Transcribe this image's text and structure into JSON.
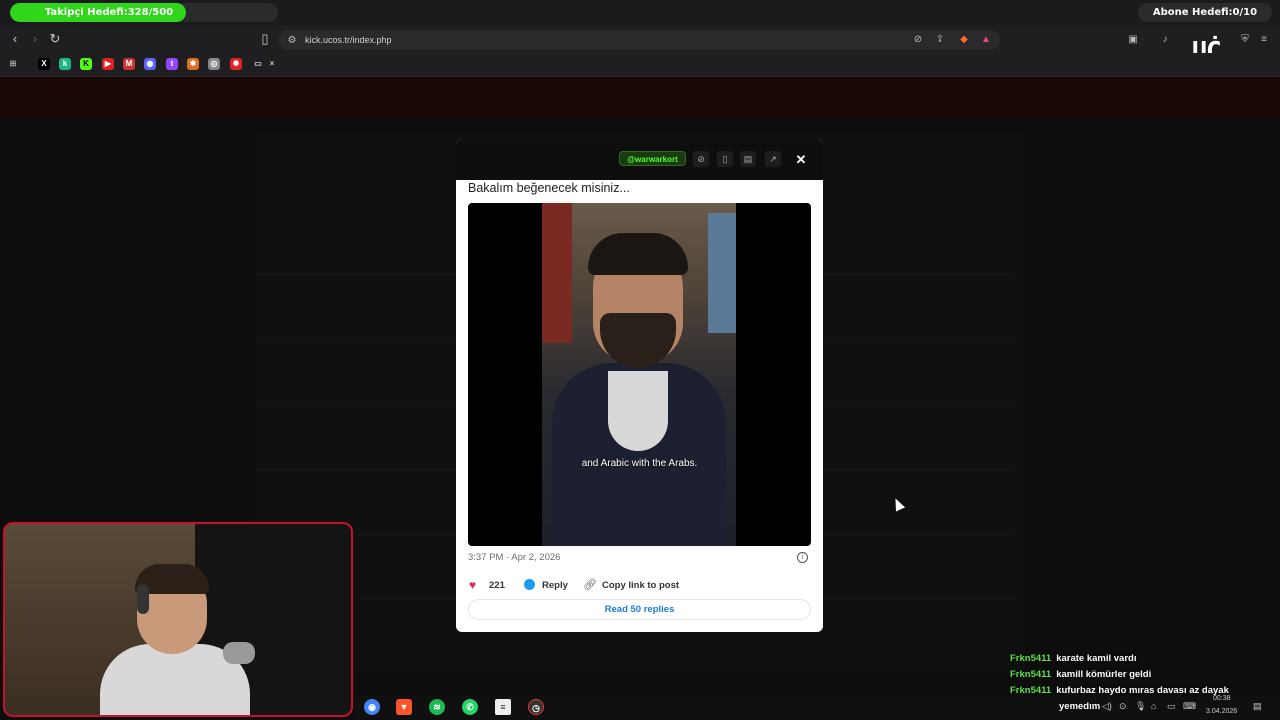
{
  "overlay": {
    "follow_goal": "Takipçi Hedefi:328/500",
    "follow_progress": 0.656,
    "sub_goal": "Abone Hedefi:0/10",
    "brand_logo": "UCO"
  },
  "browser": {
    "url": "kick.ucos.tr/index.php",
    "bookmarks": [
      "x-icon",
      "k-icon",
      "kick-icon",
      "youtube-icon",
      "gmail-icon",
      "discord-icon",
      "twitch-icon",
      "cog-icon",
      "circle-icon",
      "star-icon",
      "folder-icon"
    ]
  },
  "modal": {
    "handle": "@warwarkort",
    "tweet_text": "Bakalım beğenecek misiniz...",
    "subtitle": "and Arabic with the Arabs.",
    "timestamp": "3:37 PM · Apr 2, 2026",
    "likes": "221",
    "reply_label": "Reply",
    "copy_label": "Copy link to post",
    "read_replies": "Read 50 replies"
  },
  "chat": [
    {
      "user": "Frkn5411",
      "message": "karate kamil vardı"
    },
    {
      "user": "Frkn5411",
      "message": "kamill kömürler geldi"
    },
    {
      "user": "Frkn5411",
      "message": "kufurbaz haydo mıras davası az dayak"
    }
  ],
  "taskbar": {
    "tray_word": "yemedım",
    "time": "00:38",
    "date": "3.04.2026",
    "apps": [
      "chrome-icon",
      "brave-icon",
      "spotify-icon",
      "whatsapp-icon",
      "notepad-icon",
      "clock-app-icon"
    ]
  },
  "colors": {
    "accent_green": "#2fd61b",
    "webcam_border": "#c8102e",
    "like": "#e0245e",
    "link": "#1d7bd8"
  }
}
